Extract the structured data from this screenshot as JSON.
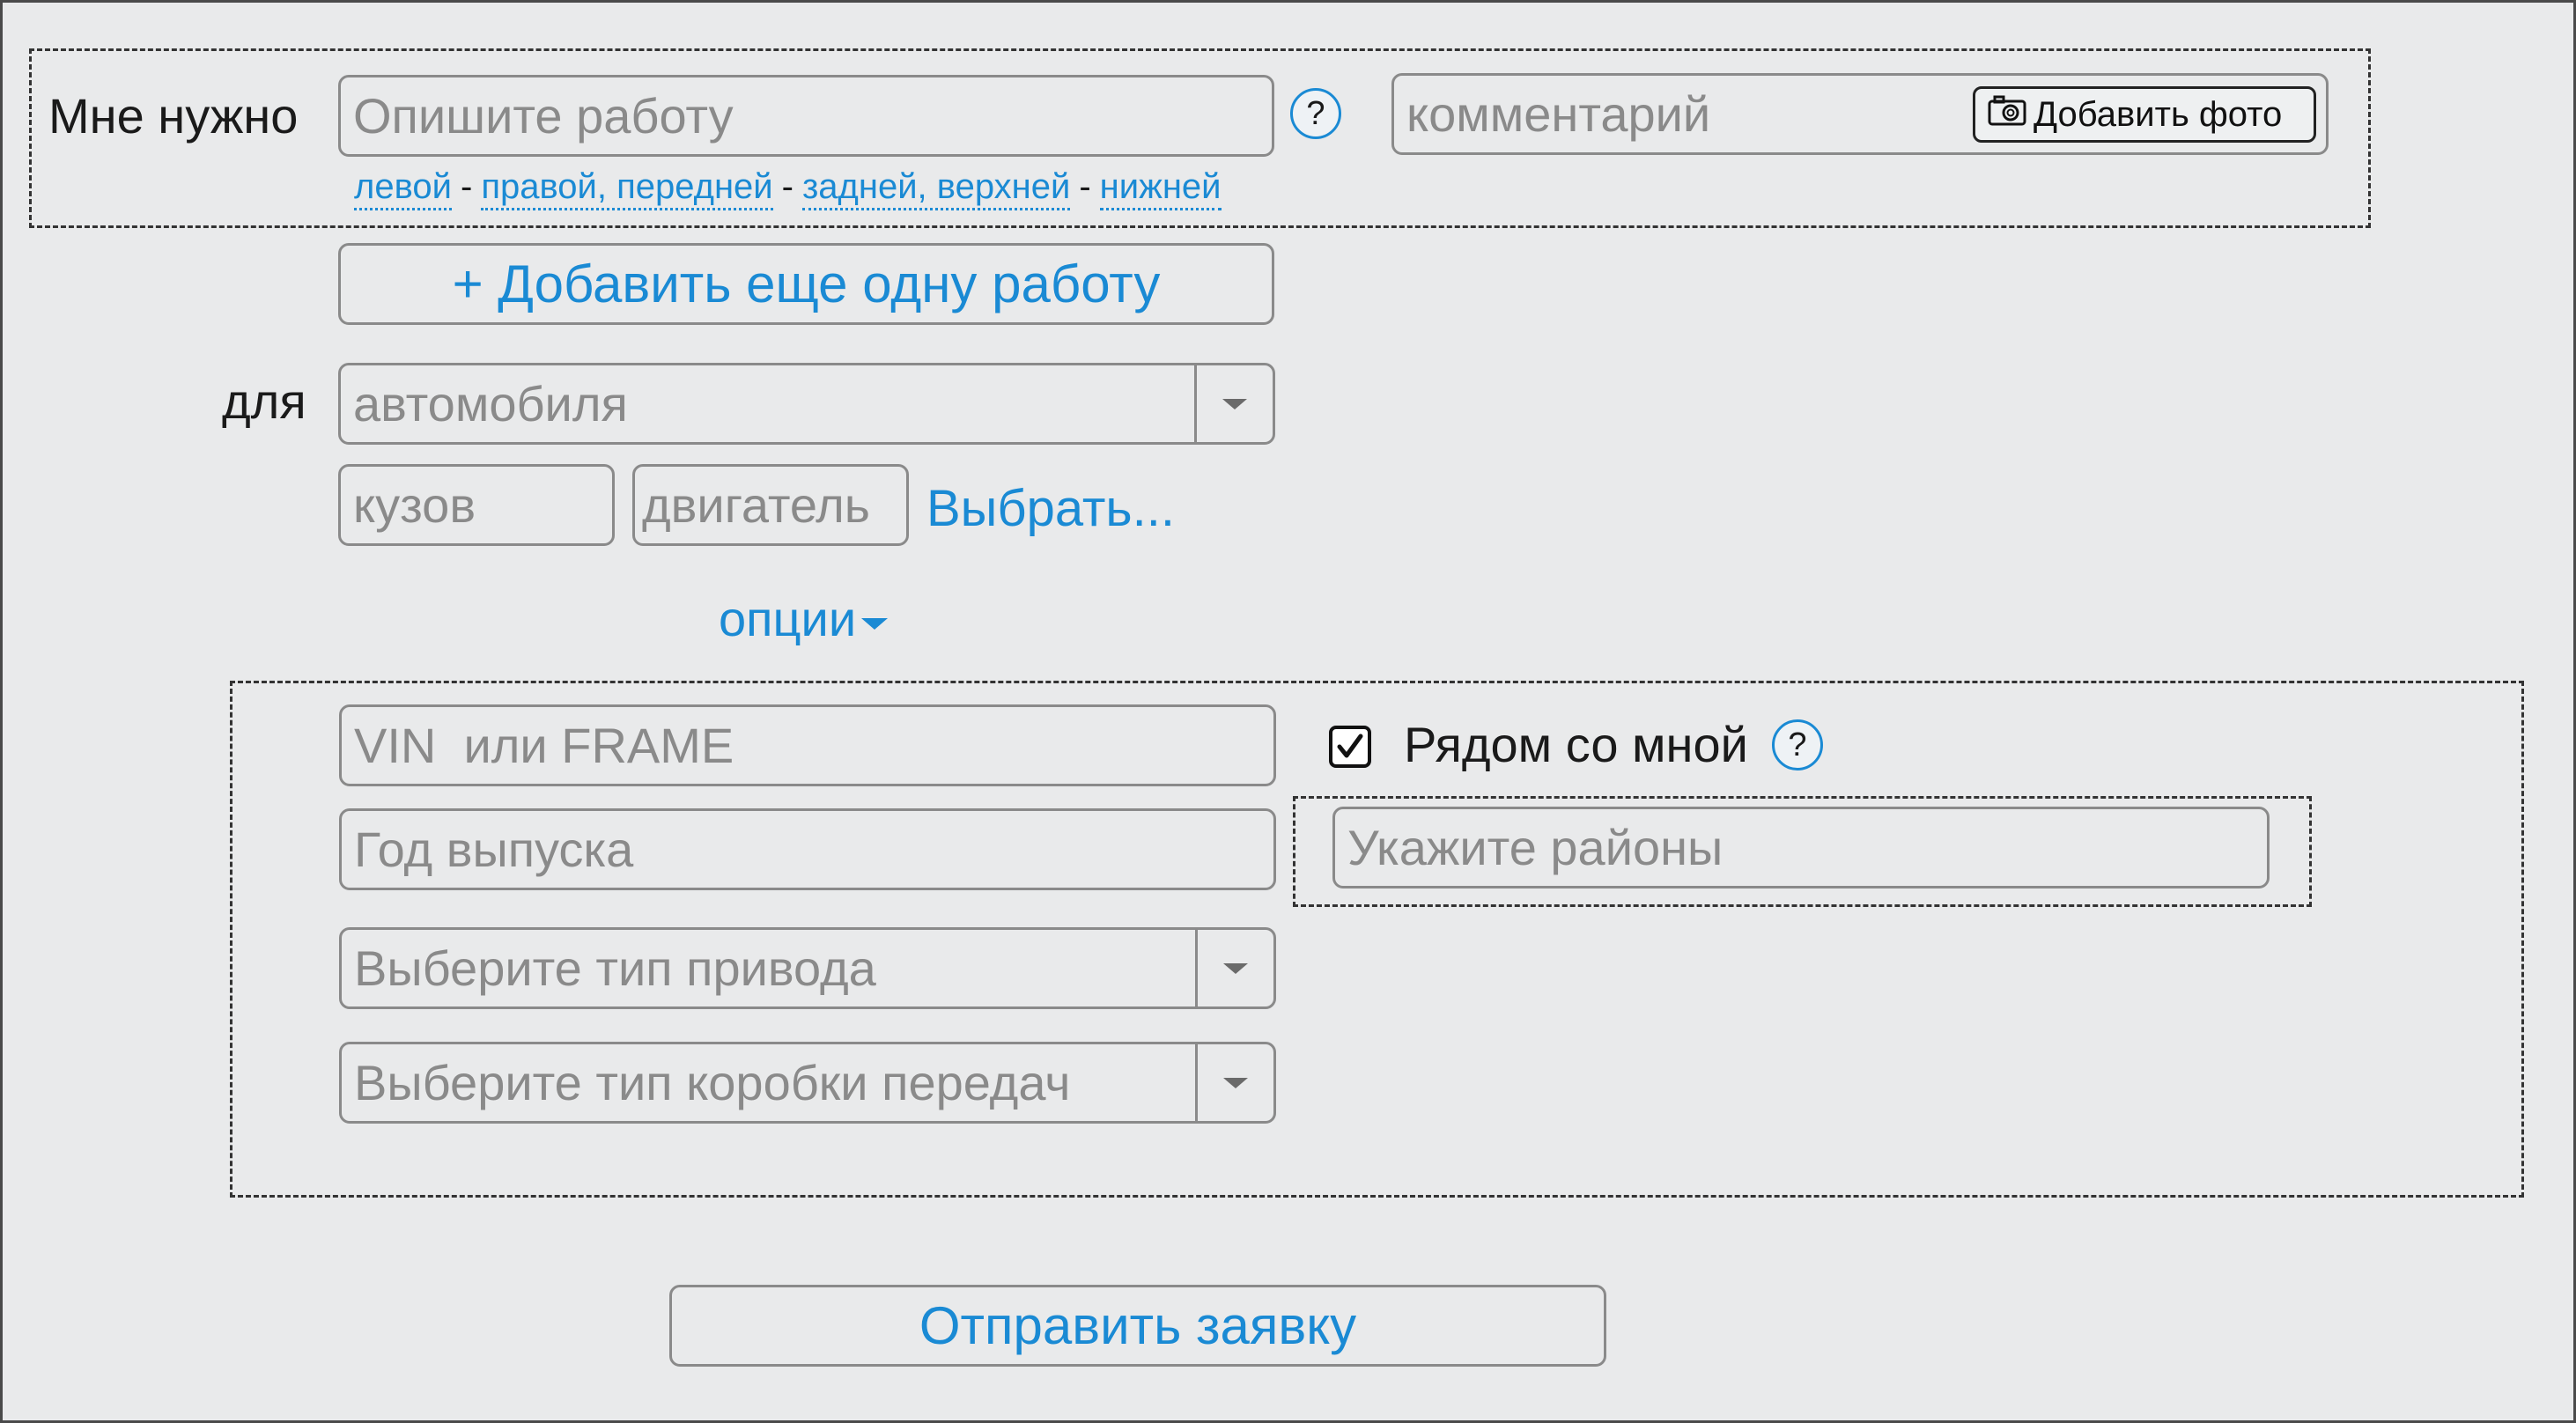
{
  "work": {
    "label": "Мне нужно",
    "input_placeholder": "Опишите работу",
    "help": "?",
    "comment_placeholder": "комментарий",
    "add_photo": "Добавить фото",
    "position_links": [
      {
        "text": "левой",
        "sep": "-"
      },
      {
        "text": "правой, передней",
        "sep": "-"
      },
      {
        "text": "задней, верхней",
        "sep": "-"
      },
      {
        "text": "нижней",
        "sep": ""
      }
    ]
  },
  "add_work_button": "+ Добавить еще одну работу",
  "vehicle": {
    "label": "для",
    "select_value": "автомобиля",
    "body_placeholder": "кузов",
    "engine_placeholder": "двигатель",
    "choose_link": "Выбрать..."
  },
  "options": {
    "toggle_label": "опции",
    "vin_placeholder": "VIN  или FRAME",
    "year_placeholder": "Год выпуска",
    "drive_placeholder": "Выберите тип привода",
    "gearbox_placeholder": "Выберите тип коробки передач",
    "near_me_label": "Рядом со мной",
    "near_me_checked": true,
    "near_me_help": "?",
    "districts_placeholder": "Укажите районы"
  },
  "submit_button": "Отправить заявку",
  "colors": {
    "accent": "#1a8ad4",
    "background": "#e9eaeb",
    "border": "#8a8a8a"
  },
  "icons": [
    "help-icon",
    "camera-icon",
    "chevron-down-icon",
    "checkbox-checked-icon"
  ]
}
